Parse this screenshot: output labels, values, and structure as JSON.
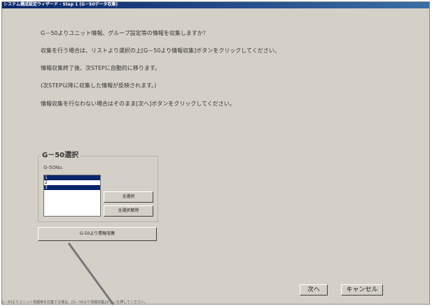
{
  "window": {
    "title": "システム構成設定ウィザード - Step 1 (G－50データ収集)"
  },
  "messages": [
    "G－50よりユニット情報、グループ設定等の情報を収集しますか？",
    "収集を行う場合は、リストより選択の上[G－50より情報収集]ボタンをクリックしてください。",
    "情報収集終了後、次STEPに自動的に移ります。",
    "(次STEP以降に収集した情報が反映されます。)",
    "情報収集を行なわない場合はそのまま[次へ]ボタンをクリックしてください。"
  ],
  "g50_group": {
    "title": "G－50選択",
    "label": "G-50No.",
    "items": [
      {
        "text": "1",
        "selected": true
      },
      {
        "text": "2",
        "selected": false
      },
      {
        "text": "3",
        "selected": true
      }
    ],
    "select_all_label": "全選択",
    "deselect_all_label": "全選択解除"
  },
  "collect_button_label": "G-50より情報収集",
  "next_button_label": "次へ",
  "cancel_button_label": "キャンセル",
  "status_text": "G－50よりユニット情報等を収集する場合、[G－50より情報収集]ボタンを押してください。"
}
